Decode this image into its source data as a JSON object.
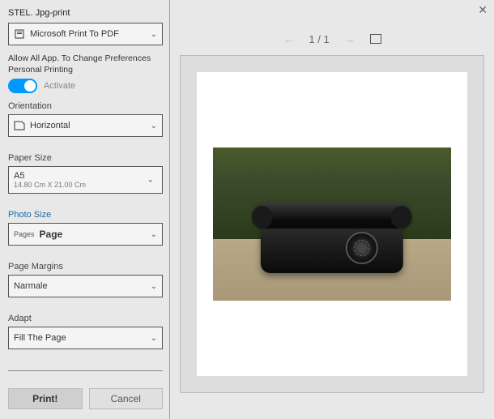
{
  "window": {
    "close": "✕"
  },
  "header": {
    "title": "STEL. Jpg-print"
  },
  "printer": {
    "selected": "Microsoft Print To PDF"
  },
  "permissions": {
    "line1": "Allow All App. To Change Preferences",
    "line2": "Personal Printing",
    "toggle_label": "Activate"
  },
  "orientation": {
    "label": "Orientation",
    "selected": "Horizontal"
  },
  "paper_size": {
    "label": "Paper Size",
    "selected": "A5",
    "dimensions": "14.80 Cm X 21.00 Cm"
  },
  "photo_size": {
    "label": "Photo Size",
    "prefix": "Pages",
    "selected": "Page"
  },
  "margins": {
    "label": "Page Margins",
    "selected": "Narmale"
  },
  "adapt": {
    "label": "Adapt",
    "selected": "Fill The Page"
  },
  "buttons": {
    "print": "Print!",
    "cancel": "Cancel"
  },
  "pager": {
    "current": "1",
    "sep": "/",
    "total": "1"
  }
}
